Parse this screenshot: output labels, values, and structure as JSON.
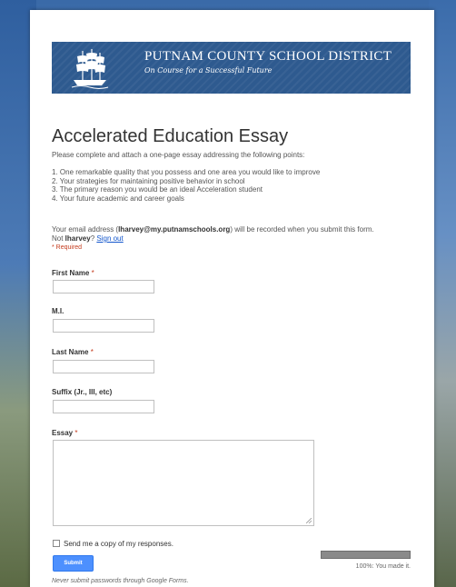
{
  "header": {
    "district_name": "PUTNAM COUNTY SCHOOL DISTRICT",
    "tagline": "On Course for a Successful Future",
    "logo_icon": "ship-icon"
  },
  "form": {
    "title": "Accelerated Education Essay",
    "description": "Please complete and attach a one-page essay addressing the following points:",
    "points": [
      "1.  One remarkable quality that you possess and one area you would like to improve",
      "2.  Your strategies for maintaining positive behavior in school",
      "3.  The primary reason you would be an ideal Acceleration student",
      "4.  Your future academic and career goals"
    ],
    "email_prefix": "Your email address (",
    "email": "lharvey@my.putnamschools.org",
    "email_suffix": ") will be recorded when you submit this form.",
    "not_user_prefix": "Not ",
    "username": "lharvey",
    "not_user_suffix": "? ",
    "sign_out": "Sign out",
    "required_note": "* Required"
  },
  "fields": {
    "first_name": {
      "label": "First Name",
      "required": " *",
      "value": ""
    },
    "mi": {
      "label": "M.I.",
      "value": ""
    },
    "last_name": {
      "label": "Last Name",
      "required": " *",
      "value": ""
    },
    "suffix": {
      "label": "Suffix (Jr., III, etc)",
      "value": ""
    },
    "essay": {
      "label": "Essay",
      "required": " *",
      "value": ""
    }
  },
  "footer": {
    "copy_label": "Send me a copy of my responses.",
    "copy_checked": false,
    "submit_label": "Submit",
    "warning": "Never submit passwords through Google Forms.",
    "progress_percent": 100,
    "progress_text": "100%: You made it."
  },
  "colors": {
    "banner": "#2e5a8f",
    "required": "#c43b1d",
    "submit": "#4d90fe",
    "link": "#1155cc"
  }
}
